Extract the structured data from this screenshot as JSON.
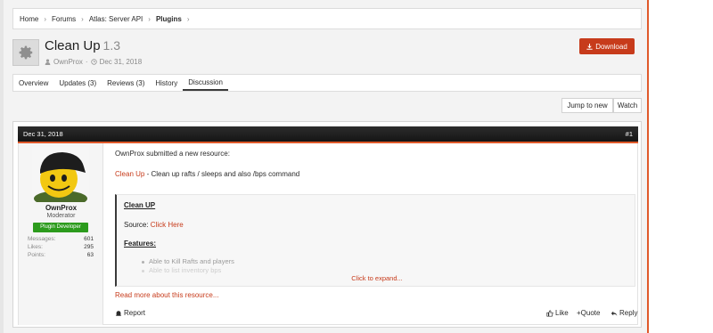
{
  "breadcrumb": {
    "items": [
      "Home",
      "Forums",
      "Atlas: Server API"
    ],
    "current": "Plugins"
  },
  "resource": {
    "title": "Clean Up",
    "version": "1.3",
    "author": "OwnProx",
    "date": "Dec 31, 2018",
    "download_label": "Download"
  },
  "tabs": [
    {
      "label": "Overview",
      "active": false
    },
    {
      "label": "Updates (3)",
      "active": false
    },
    {
      "label": "Reviews (3)",
      "active": false
    },
    {
      "label": "History",
      "active": false
    },
    {
      "label": "Discussion",
      "active": true
    }
  ],
  "actions": {
    "jump_label": "Jump to new",
    "watch_label": "Watch"
  },
  "post": {
    "date": "Dec 31, 2018",
    "number": "#1",
    "user": {
      "name": "OwnProx",
      "role": "Moderator",
      "badge": "Plugin Developer"
    },
    "stats": [
      {
        "label": "Messages:",
        "value": "601"
      },
      {
        "label": "Likes:",
        "value": "295"
      },
      {
        "label": "Points:",
        "value": "63"
      }
    ],
    "intro": "OwnProx submitted a new resource:",
    "resource_link": "Clean Up",
    "resource_desc": " - Clean up rafts / sleeps and also /bps command",
    "quote": {
      "heading": "Clean UP",
      "source_label": "Source: ",
      "source_link": "Click Here",
      "features_label": "Features:",
      "features": [
        "Able to Kill Rafts and players",
        "Able to list inventory bps"
      ],
      "expand_label": "Click to expand..."
    },
    "read_more": "Read more about this resource...",
    "report_label": "Report",
    "like_label": "Like",
    "quote_label": "+Quote",
    "reply_label": "Reply"
  },
  "colors": {
    "accent": "#c73b1b",
    "header_line": "#e0592a",
    "badge": "#2c9b1d"
  }
}
